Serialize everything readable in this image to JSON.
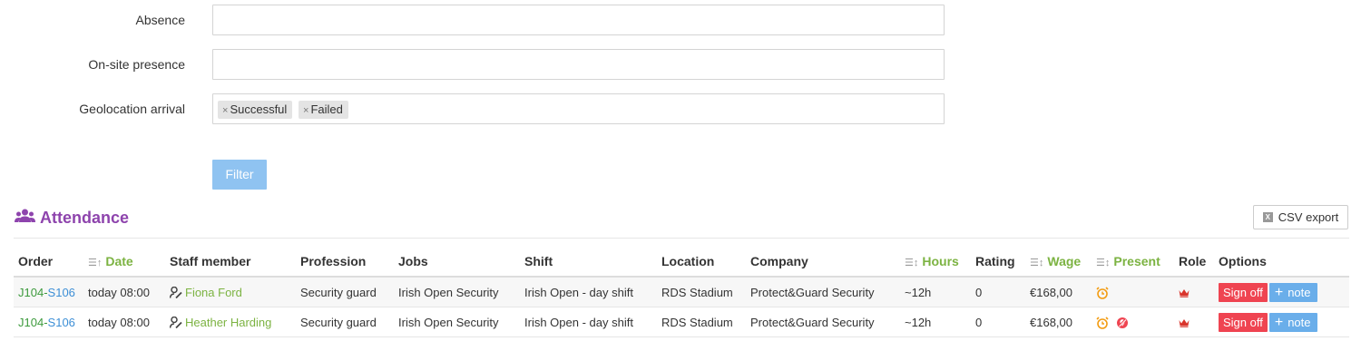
{
  "filters": {
    "absence_label": "Absence",
    "absence_value": "",
    "onsite_label": "On-site presence",
    "onsite_value": "",
    "geolocation_label": "Geolocation arrival",
    "geolocation_tags": [
      "Successful",
      "Failed"
    ],
    "tag_remove_glyph": "×",
    "filter_button": "Filter"
  },
  "section": {
    "title": "Attendance",
    "title_color": "#8e44ad",
    "csv_export": "CSV export",
    "csv_icon_text": "X"
  },
  "table": {
    "headers": {
      "order": "Order",
      "date": "Date",
      "staff": "Staff member",
      "profession": "Profession",
      "jobs": "Jobs",
      "shift": "Shift",
      "location": "Location",
      "company": "Company",
      "hours": "Hours",
      "rating": "Rating",
      "wage": "Wage",
      "present": "Present",
      "role": "Role",
      "options": "Options"
    },
    "rows": [
      {
        "order_job": "J104",
        "order_sep": "-",
        "order_shift": "S106",
        "date": "today 08:00",
        "staff": "Fiona Ford",
        "profession": "Security guard",
        "jobs": "Irish Open Security",
        "shift": "Irish Open - day shift",
        "location": "RDS Stadium",
        "company": "Protect&Guard Security",
        "hours": "~12h",
        "rating": "0",
        "wage": "€168,00",
        "present_icons": [
          "alarm-clock-icon"
        ],
        "role_icon": "crown-icon",
        "sign_off": "Sign off",
        "note": "note"
      },
      {
        "order_job": "J104",
        "order_sep": "-",
        "order_shift": "S106",
        "date": "today 08:00",
        "staff": "Heather Harding",
        "profession": "Security guard",
        "jobs": "Irish Open Security",
        "shift": "Irish Open - day shift",
        "location": "RDS Stadium",
        "company": "Protect&Guard Security",
        "hours": "~12h",
        "rating": "0",
        "wage": "€168,00",
        "present_icons": [
          "alarm-clock-icon",
          "location-off-icon"
        ],
        "role_icon": "crown-icon",
        "sign_off": "Sign off",
        "note": "note"
      }
    ]
  },
  "colors": {
    "sort_header": "#7cb342",
    "sign_off": "#ef4451",
    "note": "#6aaeea",
    "filter": "#8fc3f1"
  }
}
